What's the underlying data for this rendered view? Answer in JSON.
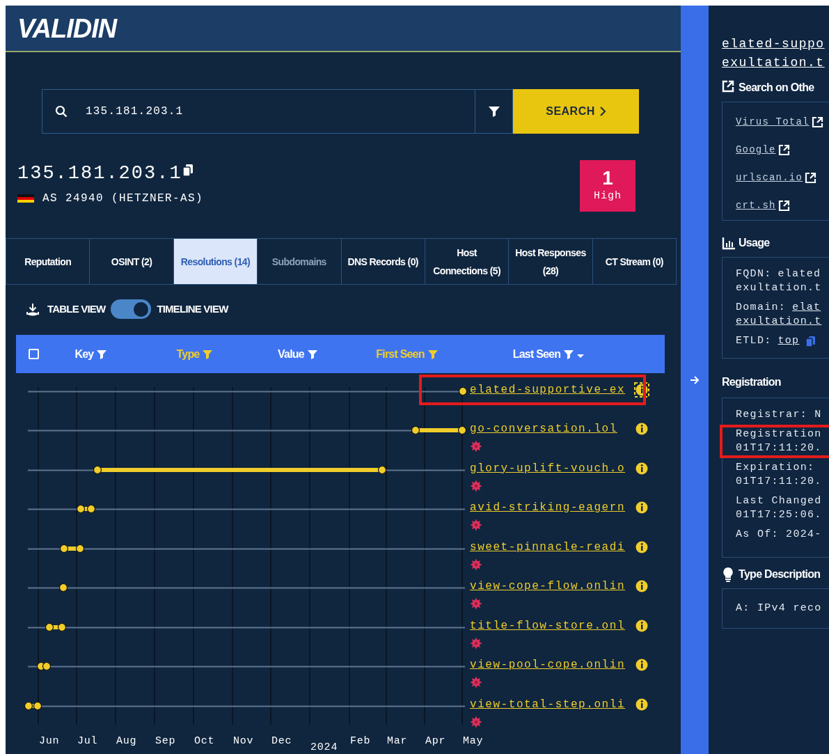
{
  "logo": "VALIDIN",
  "search": {
    "value": "135.181.203.1",
    "button": "SEARCH"
  },
  "ip": {
    "address": "135.181.203.1",
    "asn": "AS 24940 (HETZNER-AS)"
  },
  "risk": {
    "count": "1",
    "label": "High"
  },
  "tabs": [
    {
      "label": "Reputation",
      "selected": false,
      "disabled": false
    },
    {
      "label": "OSINT (2)",
      "selected": false,
      "disabled": false
    },
    {
      "label": "Resolutions (14)",
      "selected": true,
      "disabled": false
    },
    {
      "label": "Subdomains",
      "selected": false,
      "disabled": true
    },
    {
      "label": "DNS Records (0)",
      "selected": false,
      "disabled": false
    },
    {
      "label": "Host Connections (5)",
      "selected": false,
      "disabled": false
    },
    {
      "label": "Host Responses (28)",
      "selected": false,
      "disabled": false
    },
    {
      "label": "CT Stream (0)",
      "selected": false,
      "disabled": false
    }
  ],
  "view_toggle": {
    "left": "TABLE VIEW",
    "right": "TIMELINE VIEW",
    "on": true
  },
  "header_checkbox": {
    "checked": false
  },
  "columns": [
    {
      "label": "Key",
      "filtered": false,
      "sorted": false
    },
    {
      "label": "Type",
      "filtered": true,
      "sorted": false
    },
    {
      "label": "Value",
      "filtered": false,
      "sorted": false
    },
    {
      "label": "First Seen",
      "filtered": true,
      "sorted": false
    },
    {
      "label": "Last Seen",
      "filtered": false,
      "sorted": true
    }
  ],
  "timeline_rows": [
    {
      "domain": "elated-supportive-ex",
      "highlighted": true,
      "flagged": false
    },
    {
      "domain": "go-conversation.lol",
      "highlighted": false,
      "flagged": true
    },
    {
      "domain": "glory-uplift-vouch.o",
      "highlighted": false,
      "flagged": true
    },
    {
      "domain": "avid-striking-eagern",
      "highlighted": false,
      "flagged": true
    },
    {
      "domain": "sweet-pinnacle-readi",
      "highlighted": false,
      "flagged": true
    },
    {
      "domain": "view-cope-flow.onlin",
      "highlighted": false,
      "flagged": true
    },
    {
      "domain": "title-flow-store.onl",
      "highlighted": false,
      "flagged": true
    },
    {
      "domain": "view-pool-cope.onlin",
      "highlighted": false,
      "flagged": true
    },
    {
      "domain": "view-total-step.onli",
      "highlighted": false,
      "flagged": true
    }
  ],
  "axis_labels": [
    {
      "label": "Jun",
      "kind": "month"
    },
    {
      "label": "Jul",
      "kind": "month"
    },
    {
      "label": "Aug",
      "kind": "month"
    },
    {
      "label": "Sep",
      "kind": "month"
    },
    {
      "label": "Oct",
      "kind": "month"
    },
    {
      "label": "Nov",
      "kind": "month"
    },
    {
      "label": "Dec",
      "kind": "month"
    },
    {
      "label": "2024",
      "kind": "year"
    },
    {
      "label": "Feb",
      "kind": "month"
    },
    {
      "label": "Mar",
      "kind": "month"
    },
    {
      "label": "Apr",
      "kind": "month"
    },
    {
      "label": "May",
      "kind": "month"
    }
  ],
  "detail": {
    "title_lines": [
      "elated-suppo",
      "exultation.t"
    ],
    "search_other": {
      "heading": "Search on Othe",
      "links": [
        "Virus Total",
        "Google",
        "urlscan.io",
        "crt.sh"
      ]
    },
    "usage": {
      "heading": "Usage",
      "items": [
        {
          "kind": "text",
          "label": "FQDN:",
          "value": "elated",
          "continuation": "exultation.t"
        },
        {
          "kind": "link",
          "label": "Domain:",
          "value": "elat",
          "continuation": "exultation.t"
        },
        {
          "kind": "link-copy",
          "label": "ETLD:",
          "value": "top"
        }
      ]
    },
    "registration": {
      "heading": "Registration",
      "items": [
        {
          "text": "Registrar: N",
          "highlighted": false
        },
        {
          "text": "Registration",
          "continuation": "01T17:11:20.",
          "highlighted": true
        },
        {
          "text": "Expiration:",
          "continuation": "01T17:11:20.",
          "highlighted": false
        },
        {
          "text": "Last Changed",
          "continuation": "01T17:25:06.",
          "highlighted": false
        },
        {
          "text": "As Of: 2024-",
          "highlighted": false
        }
      ]
    },
    "type_description": {
      "heading": "Type Description",
      "text": "A: IPv4 reco"
    }
  }
}
